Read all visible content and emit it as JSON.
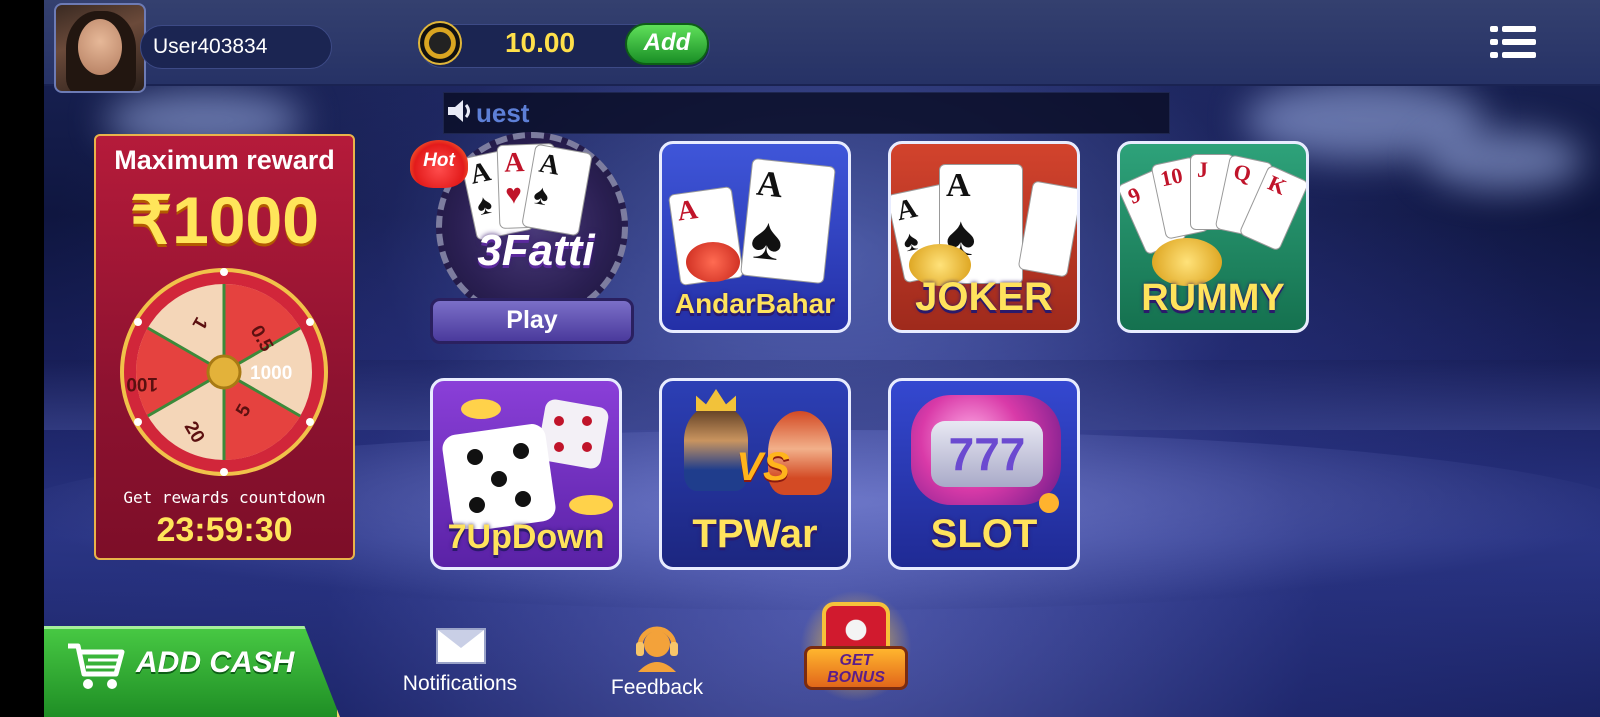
{
  "header": {
    "username": "User403834",
    "balance": "10.00",
    "add_label": "Add"
  },
  "marquee": {
    "text": "uest"
  },
  "reward": {
    "title": "Maximum reward",
    "amount": "₹1000",
    "wheel_segments": [
      "0.5",
      "1000",
      "5",
      "20",
      "100",
      "1"
    ],
    "countdown_label": "Get rewards countdown",
    "countdown": "23:59:30"
  },
  "games": {
    "teen_patti": {
      "logo": "3Fatti",
      "badge": "Hot",
      "play_label": "Play"
    },
    "andar_bahar": {
      "label": "AndarBahar"
    },
    "joker": {
      "label": "JOKER"
    },
    "rummy": {
      "label": "RUMMY",
      "cards": [
        "9",
        "10",
        "J",
        "Q",
        "K"
      ]
    },
    "seven_up_down": {
      "label": "7UpDown"
    },
    "tp_war": {
      "label": "TPWar",
      "vs": "VS"
    },
    "slot": {
      "label": "SLOT",
      "reel": "777"
    }
  },
  "bottom": {
    "add_cash": "ADD CASH",
    "notifications": "Notifications",
    "feedback": "Feedback",
    "get_bonus_line1": "GET",
    "get_bonus_line2": "BONUS"
  },
  "colors": {
    "accent_gold": "#ffe35c",
    "add_green": "#1f8e25",
    "reward_red": "#8d1230"
  }
}
